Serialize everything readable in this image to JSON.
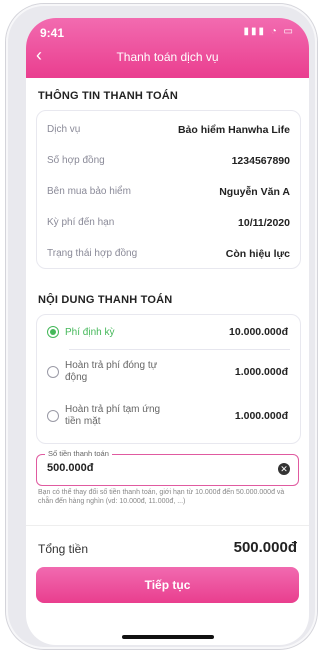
{
  "status": {
    "time": "9:41",
    "icons": "▮▮▮ ◔ ▭"
  },
  "header": {
    "back_icon": "chevron-left-icon",
    "title": "Thanh toán dịch vụ"
  },
  "payment_info": {
    "section_title": "THÔNG TIN THANH TOÁN",
    "rows": [
      {
        "label": "Dịch vụ",
        "value": "Bảo hiểm Hanwha Life"
      },
      {
        "label": "Số hợp đồng",
        "value": "1234567890"
      },
      {
        "label": "Bên mua bảo hiểm",
        "value": "Nguyễn Văn A"
      },
      {
        "label": "Kỳ phí đến hạn",
        "value": "10/11/2020"
      },
      {
        "label": "Trạng thái hợp đồng",
        "value": "Còn hiệu lực"
      }
    ]
  },
  "payment_content": {
    "section_title": "NỘI DUNG THANH TOÁN",
    "options": [
      {
        "label": "Phí định kỳ",
        "amount": "10.000.000đ",
        "selected": true
      },
      {
        "label": "Hoàn trả phí đóng tự động",
        "amount": "1.000.000đ",
        "selected": false
      },
      {
        "label": "Hoàn trả phí tạm ứng tiền mặt",
        "amount": "1.000.000đ",
        "selected": false
      }
    ]
  },
  "amount_field": {
    "label": "Số tiền thanh toán",
    "value": "500.000đ",
    "helper": "Bạn có thể thay đổi số tiền thanh toán, giới hạn từ 10.000đ đến 50.000.000đ và chẵn đến hàng nghìn (vd: 10.000đ, 11.000đ, ...)"
  },
  "total": {
    "label": "Tổng tiền",
    "value": "500.000đ"
  },
  "cta": {
    "label": "Tiếp tục"
  },
  "colors": {
    "primary": "#ea3e8f",
    "selected": "#45b85a"
  }
}
